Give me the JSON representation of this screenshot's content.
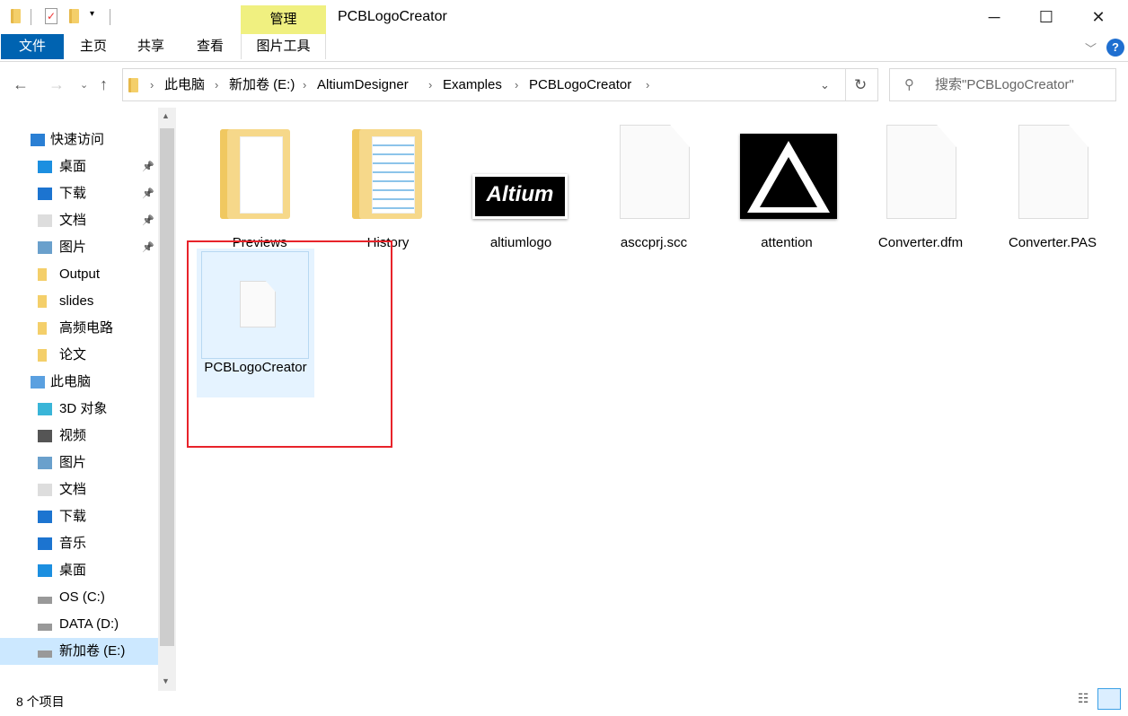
{
  "window": {
    "title": "PCBLogoCreator",
    "context_tab": "管理"
  },
  "ribbon": {
    "tabs": [
      "文件",
      "主页",
      "共享",
      "查看",
      "图片工具"
    ]
  },
  "address": {
    "crumbs": [
      "此电脑",
      "新加卷 (E:)",
      "AltiumDesigner",
      "Examples",
      "PCBLogoCreator"
    ]
  },
  "search": {
    "placeholder": "搜索\"PCBLogoCreator\""
  },
  "sidebar": {
    "items": [
      {
        "label": "快速访问",
        "icon": "star-icon",
        "group": true
      },
      {
        "label": "桌面",
        "icon": "desktop-icon",
        "pinned": true
      },
      {
        "label": "下载",
        "icon": "download-icon",
        "pinned": true
      },
      {
        "label": "文档",
        "icon": "document-icon",
        "pinned": true
      },
      {
        "label": "图片",
        "icon": "picture-icon",
        "pinned": true
      },
      {
        "label": "Output",
        "icon": "folder-icon"
      },
      {
        "label": "slides",
        "icon": "folder-icon"
      },
      {
        "label": "高频电路",
        "icon": "folder-icon"
      },
      {
        "label": "论文",
        "icon": "folder-icon"
      },
      {
        "label": "此电脑",
        "icon": "computer-icon",
        "group": true
      },
      {
        "label": "3D 对象",
        "icon": "3d-objects-icon"
      },
      {
        "label": "视频",
        "icon": "video-icon"
      },
      {
        "label": "图片",
        "icon": "picture-icon"
      },
      {
        "label": "文档",
        "icon": "document-icon"
      },
      {
        "label": "下载",
        "icon": "download-icon"
      },
      {
        "label": "音乐",
        "icon": "music-icon"
      },
      {
        "label": "桌面",
        "icon": "desktop-icon"
      },
      {
        "label": "OS (C:)",
        "icon": "drive-icon"
      },
      {
        "label": "DATA (D:)",
        "icon": "drive-icon"
      },
      {
        "label": "新加卷 (E:)",
        "icon": "drive-icon",
        "selected": true
      }
    ]
  },
  "files": [
    {
      "name": "_Previews",
      "type": "folder"
    },
    {
      "name": "History",
      "type": "folder"
    },
    {
      "name": "altiumlogo",
      "type": "image",
      "logo_text": "Altium"
    },
    {
      "name": "asccprj.scc",
      "type": "file"
    },
    {
      "name": "attention",
      "type": "image"
    },
    {
      "name": "Converter.dfm",
      "type": "file"
    },
    {
      "name": "Converter.PAS",
      "type": "file"
    },
    {
      "name": "PCBLogoCreator",
      "type": "file",
      "selected": true,
      "highlighted": true
    }
  ],
  "status": {
    "count": "8 个项目"
  },
  "colors": {
    "accent": "#0063b1",
    "context_tab": "#f0f080",
    "highlight": "#e8232a",
    "selection": "#e5f3ff"
  }
}
